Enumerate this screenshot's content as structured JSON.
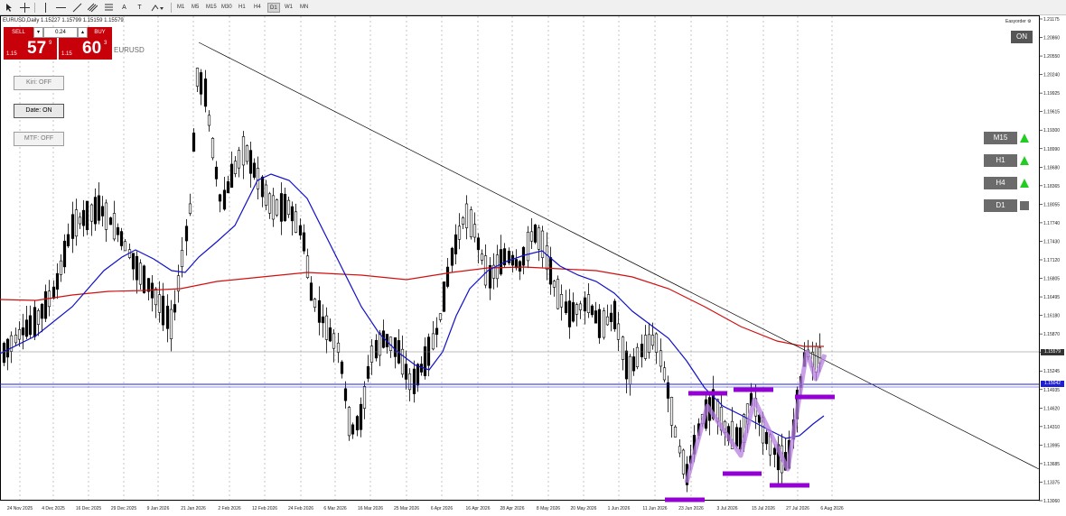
{
  "toolbar": {
    "tools": [
      "cursor-icon",
      "crosshair-icon",
      "vertical-line-icon",
      "horizontal-line-icon",
      "trendline-icon",
      "channel-icon",
      "fibonacci-icon",
      "gann-icon",
      "text-icon",
      "text-label-icon",
      "shapes-icon"
    ],
    "text_tool_label": "A",
    "label_tool_label": "T",
    "timeframes": [
      "M1",
      "M5",
      "M15",
      "M30",
      "H1",
      "H4",
      "D1",
      "W1",
      "MN"
    ],
    "active_timeframe": "D1"
  },
  "chart": {
    "title": "EURUSD,Daily  1.15227 1.15799 1.15159 1.15579",
    "symbol": "EURUSD",
    "sell_label": "SELL",
    "buy_label": "BUY",
    "lot": "0.24",
    "sell_prefix": "1.15",
    "sell_big": "57",
    "sell_sup": "9",
    "buy_prefix": "1.15",
    "buy_big": "60",
    "buy_sup": "3"
  },
  "side_buttons": {
    "kiri": "Kiri: OFF",
    "date": "Date: ON",
    "mtf": "MTF: OFF"
  },
  "easyorder": {
    "label": "Easyorder ⚙",
    "on": "ON"
  },
  "mtf_panel": [
    {
      "label": "M15",
      "state": "up"
    },
    {
      "label": "H1",
      "state": "up"
    },
    {
      "label": "H4",
      "state": "up"
    },
    {
      "label": "D1",
      "state": "neutral"
    }
  ],
  "price_axis": [
    "1.21175",
    "1.20860",
    "1.20550",
    "1.20240",
    "1.19925",
    "1.19615",
    "1.19300",
    "1.18990",
    "1.18680",
    "1.18365",
    "1.18055",
    "1.17740",
    "1.17430",
    "1.17120",
    "1.16805",
    "1.16495",
    "1.16180",
    "1.15870",
    "1.15560",
    "1.15245",
    "1.14935",
    "1.14620",
    "1.14310",
    "1.13995",
    "1.13685",
    "1.13375",
    "1.13060"
  ],
  "current_price_tag": "1.15579",
  "line_price_tag": "1.15042",
  "date_axis": [
    "24 Nov 2025",
    "4 Dec 2025",
    "16 Dec 2025",
    "29 Dec 2025",
    "9 Jan 2026",
    "21 Jan 2026",
    "2 Feb 2026",
    "12 Feb 2026",
    "24 Feb 2026",
    "6 Mar 2026",
    "16 Mar 2026",
    "25 Mar 2026",
    "6 Apr 2026",
    "16 Apr 2026",
    "28 Apr 2026",
    "8 May 2026",
    "20 May 2026",
    "1 Jun 2026",
    "11 Jun 2026",
    "23 Jun 2026",
    "3 Jul 2026",
    "15 Jul 2026",
    "27 Jul 2026",
    "6 Aug 2026"
  ],
  "colors": {
    "candle": "#000000",
    "ma_fast": "#1010c8",
    "ma_slow": "#d01010",
    "level_line": "#2020d0",
    "pattern": "#9400d3",
    "pattern_light": "#b57fe0",
    "buy_sell": "#c8000a",
    "arrow_up": "#22cc22"
  }
}
